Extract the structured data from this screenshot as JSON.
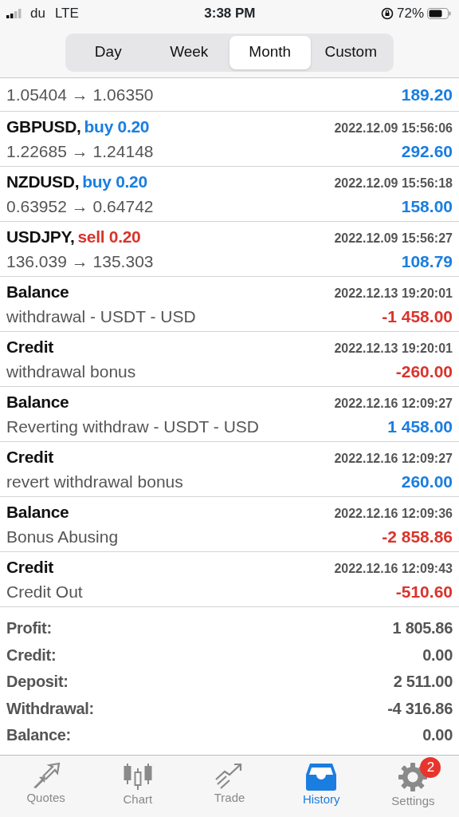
{
  "status_bar": {
    "carrier": "du",
    "network": "LTE",
    "time": "3:38 PM",
    "battery": "72%"
  },
  "periods": [
    {
      "label": "Day",
      "selected": false
    },
    {
      "label": "Week",
      "selected": false
    },
    {
      "label": "Month",
      "selected": true
    },
    {
      "label": "Custom",
      "selected": false
    }
  ],
  "deals": [
    {
      "kind": "partial",
      "detail": "1.05404 → 1.06350",
      "amount": "189.20",
      "color": "#1a7ee0"
    },
    {
      "kind": "trade",
      "title": "GBPUSD,",
      "order": {
        "text": "buy 0.20",
        "color": "#1a7ee0"
      },
      "time": "2022.12.09 15:56:06",
      "detail": "1.22685 → 1.24148",
      "amount": "292.60",
      "color": "#1a7ee0"
    },
    {
      "kind": "trade",
      "title": "NZDUSD,",
      "order": {
        "text": "buy 0.20",
        "color": "#1a7ee0"
      },
      "time": "2022.12.09 15:56:18",
      "detail": "0.63952 → 0.64742",
      "amount": "158.00",
      "color": "#1a7ee0"
    },
    {
      "kind": "trade",
      "title": "USDJPY,",
      "order": {
        "text": "sell 0.20",
        "color": "#d9342b"
      },
      "time": "2022.12.09 15:56:27",
      "detail": "136.039 → 135.303",
      "amount": "108.79",
      "color": "#1a7ee0"
    },
    {
      "kind": "operation",
      "title": "Balance",
      "time": "2022.12.13 19:20:01",
      "detail": "withdrawal - USDT - USD",
      "amount": "-1 458.00",
      "color": "#d9342b"
    },
    {
      "kind": "operation",
      "title": "Credit",
      "time": "2022.12.13 19:20:01",
      "detail": "withdrawal bonus",
      "amount": "-260.00",
      "color": "#d9342b"
    },
    {
      "kind": "operation",
      "title": "Balance",
      "time": "2022.12.16 12:09:27",
      "detail": "Reverting withdraw - USDT - USD",
      "amount": "1 458.00",
      "color": "#1a7ee0"
    },
    {
      "kind": "operation",
      "title": "Credit",
      "time": "2022.12.16 12:09:27",
      "detail": "revert withdrawal bonus",
      "amount": "260.00",
      "color": "#1a7ee0"
    },
    {
      "kind": "operation",
      "title": "Balance",
      "time": "2022.12.16 12:09:36",
      "detail": "Bonus Abusing",
      "amount": "-2 858.86",
      "color": "#d9342b"
    },
    {
      "kind": "operation",
      "title": "Credit",
      "time": "2022.12.16 12:09:43",
      "detail": "Credit Out",
      "amount": "-510.60",
      "color": "#d9342b"
    }
  ],
  "summary": [
    {
      "label": "Profit:",
      "value": "1 805.86"
    },
    {
      "label": "Credit:",
      "value": "0.00"
    },
    {
      "label": "Deposit:",
      "value": "2 511.00"
    },
    {
      "label": "Withdrawal:",
      "value": "-4 316.86"
    },
    {
      "label": "Balance:",
      "value": "0.00"
    }
  ],
  "tab_bar": [
    {
      "label": "Quotes",
      "selected": false
    },
    {
      "label": "Chart",
      "selected": false
    },
    {
      "label": "Trade",
      "selected": false
    },
    {
      "label": "History",
      "selected": true
    },
    {
      "label": "Settings",
      "selected": false,
      "badge": "2"
    }
  ]
}
